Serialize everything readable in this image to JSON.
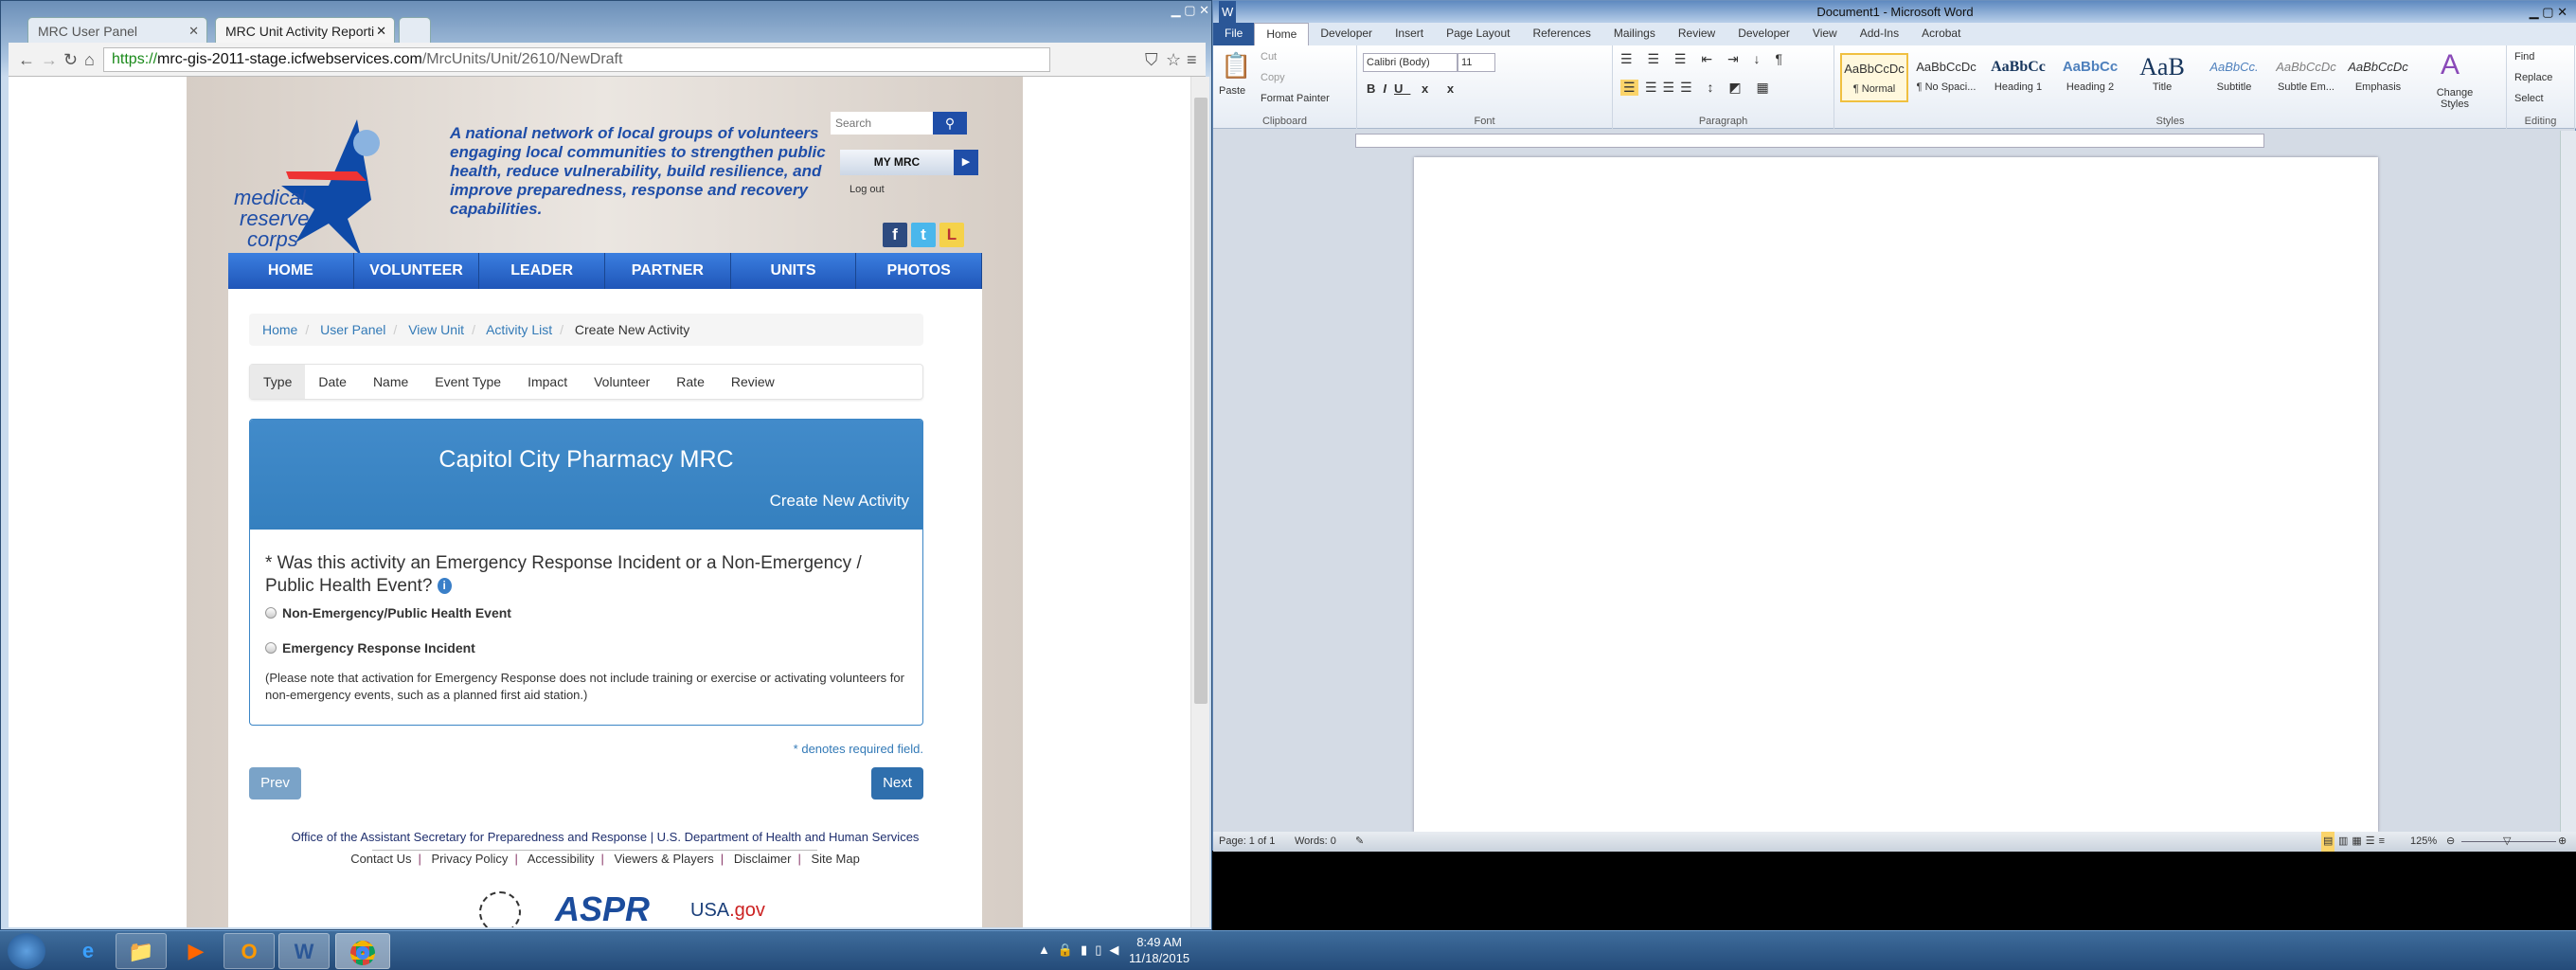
{
  "browser": {
    "tabs": [
      {
        "label": "MRC User Panel"
      },
      {
        "label": "MRC Unit Activity Reporti"
      }
    ],
    "url": {
      "scheme": "https://",
      "host": "mrc-gis-2011-stage.icfwebservices.com",
      "path": "/MrcUnits/Unit/2610/NewDraft"
    }
  },
  "site": {
    "logo_text": "medical reserve corps",
    "tagline": "A national network of local groups of volunteers engaging local communities to strengthen public health, reduce vulnerability, build resilience, and improve preparedness, response and recovery capabilities.",
    "search_placeholder": "Search",
    "my_mrc": "MY MRC",
    "logout": "Log out",
    "social": [
      "f",
      "t",
      "L"
    ],
    "nav": [
      "HOME",
      "VOLUNTEER",
      "LEADER",
      "PARTNER",
      "UNITS",
      "PHOTOS"
    ],
    "breadcrumb": [
      "Home",
      "User Panel",
      "View Unit",
      "Activity List",
      "Create New Activity"
    ],
    "steps": [
      "Type",
      "Date",
      "Name",
      "Event Type",
      "Impact",
      "Volunteer",
      "Rate",
      "Review"
    ],
    "panel": {
      "title": "Capitol City Pharmacy MRC",
      "subtitle": "Create New Activity"
    },
    "question": "* Was this activity an Emergency Response Incident or a Non-Emergency / Public Health Event?",
    "options": [
      "Non-Emergency/Public Health Event",
      "Emergency Response Incident"
    ],
    "note": "(Please note that activation for Emergency Response does not include training or exercise or activating volunteers for non-emergency events, such as a planned first aid station.)",
    "required_star": "*",
    "required_text": " denotes required field.",
    "prev": "Prev",
    "next": "Next",
    "footer_line": "Office of the Assistant Secretary for Preparedness and Response | U.S. Department of Health and Human Services",
    "footer_links": [
      "Contact Us",
      "Privacy Policy",
      "Accessibility",
      "Viewers & Players",
      "Disclaimer",
      "Site Map"
    ],
    "aspr": "ASPR",
    "usa": "USA",
    "gov": ".gov"
  },
  "taskbar": {
    "time": "8:49 AM",
    "date": "11/18/2015"
  },
  "word": {
    "title": "Document1 - Microsoft Word",
    "tabs": [
      "File",
      "Home",
      "Developer",
      "Insert",
      "Page Layout",
      "References",
      "Mailings",
      "Review",
      "Developer",
      "View",
      "Add-Ins",
      "Acrobat"
    ],
    "clipboard": {
      "paste": "Paste",
      "cut": "Cut",
      "copy": "Copy",
      "format_painter": "Format Painter",
      "label": "Clipboard"
    },
    "font": {
      "name": "Calibri (Body)",
      "size": "11",
      "label": "Font"
    },
    "paragraph_label": "Paragraph",
    "styles": [
      {
        "sample": "AaBbCcDc",
        "name": "¶ Normal"
      },
      {
        "sample": "AaBbCcDc",
        "name": "¶ No Spaci..."
      },
      {
        "sample": "AaBbCc",
        "name": "Heading 1"
      },
      {
        "sample": "AaBbCc",
        "name": "Heading 2"
      },
      {
        "sample": "AaB",
        "name": "Title"
      },
      {
        "sample": "AaBbCc.",
        "name": "Subtitle"
      },
      {
        "sample": "AaBbCcDc",
        "name": "Subtle Em..."
      },
      {
        "sample": "AaBbCcDc",
        "name": "Emphasis"
      }
    ],
    "styles_label": "Styles",
    "change_styles": "Change Styles",
    "editing": {
      "find": "Find",
      "replace": "Replace",
      "select": "Select",
      "label": "Editing"
    },
    "status": {
      "page": "Page: 1 of 1",
      "words": "Words: 0",
      "zoom": "125%"
    },
    "zoom_percent": 125
  }
}
